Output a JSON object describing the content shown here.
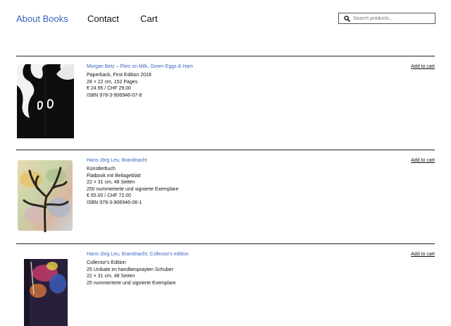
{
  "nav": {
    "about": "About Books",
    "contact": "Contact",
    "cart": "Cart"
  },
  "search": {
    "placeholder": "Search products..."
  },
  "products": [
    {
      "title": "Morgan Betz – Flies on Milk, Green Eggs & Ham",
      "lines": [
        "Paperback, First Edition 2018",
        "28 × 22 cm, 152 Pages",
        "€ 24.95 / CHF 29.00",
        "ISBN 978-3-906946-07-8"
      ],
      "add_label": "Add to cart"
    },
    {
      "title": "Hans-Jörg Leu, Brandnacht",
      "lines": [
        "Künstlerbuch",
        "Flatbook mit Beilageblatt",
        "22 × 31 cm, 48 Seiten",
        "250 nummerierte und signierte Exemplare",
        "€ 65.00 / CHF 72.00",
        "ISBN 978-3-906946-06-1"
      ],
      "add_label": "Add to cart"
    },
    {
      "title": "Hans-Jörg Leu, Brandnacht, Collector's edition",
      "lines": [
        "Collector's Edition",
        "25 Unikate im handbesprayten Schuber",
        "22 × 31 cm, 48 Seiten",
        "25 nummerierte und signierte Exemplare"
      ],
      "add_label": "Add to cart"
    }
  ],
  "colors": {
    "link": "#3b64c4",
    "text": "#111111",
    "divider": "#222222"
  }
}
